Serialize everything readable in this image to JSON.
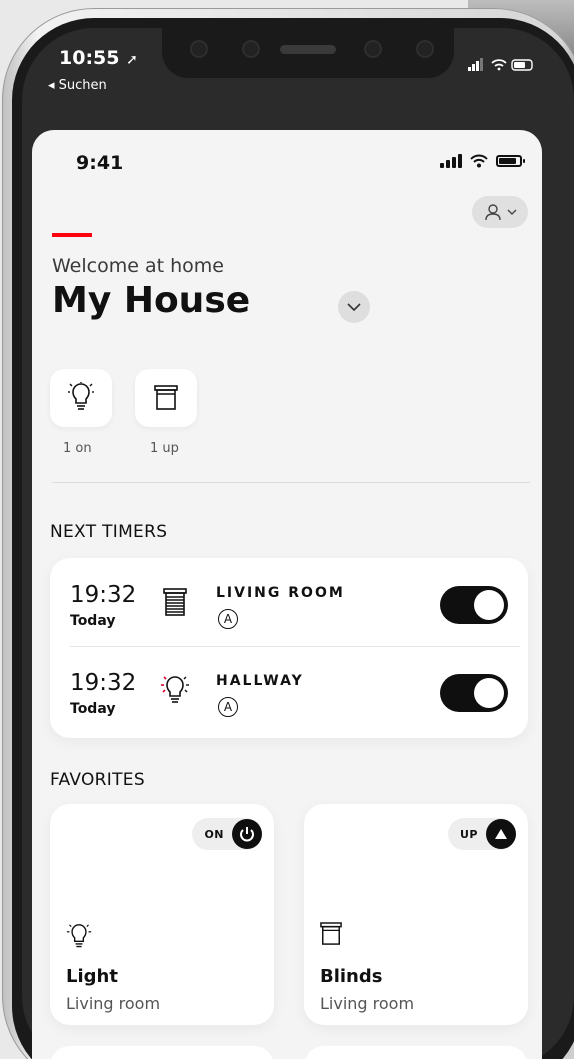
{
  "outer": {
    "time": "10:55",
    "back_label": "◂ Suchen"
  },
  "status": {
    "time": "9:41"
  },
  "header": {
    "welcome": "Welcome at home",
    "house_name": "My House"
  },
  "quick": [
    {
      "label": "1 on",
      "icon": "lightbulb-icon"
    },
    {
      "label": "1 up",
      "icon": "blinds-icon"
    }
  ],
  "timers": {
    "title": "NEXT TIMERS",
    "rows": [
      {
        "time": "19:32",
        "day": "Today",
        "room": "LIVING ROOM",
        "mode": "A",
        "icon": "blinds-icon",
        "enabled": true
      },
      {
        "time": "19:32",
        "day": "Today",
        "room": "HALLWAY",
        "mode": "A",
        "icon": "lightbulb-icon",
        "enabled": true
      }
    ]
  },
  "favorites": {
    "title": "FAVORITES",
    "items": [
      {
        "state": "ON",
        "name": "Light",
        "room": "Living room",
        "icon": "lightbulb-icon",
        "action_icon": "power-icon"
      },
      {
        "state": "UP",
        "name": "Blinds",
        "room": "Living room",
        "icon": "blinds-icon",
        "action_icon": "arrow-up-icon"
      }
    ]
  },
  "colors": {
    "accent": "#ff000f",
    "toggle_on": "#0f0f0f",
    "background": "#f4f4f4"
  }
}
